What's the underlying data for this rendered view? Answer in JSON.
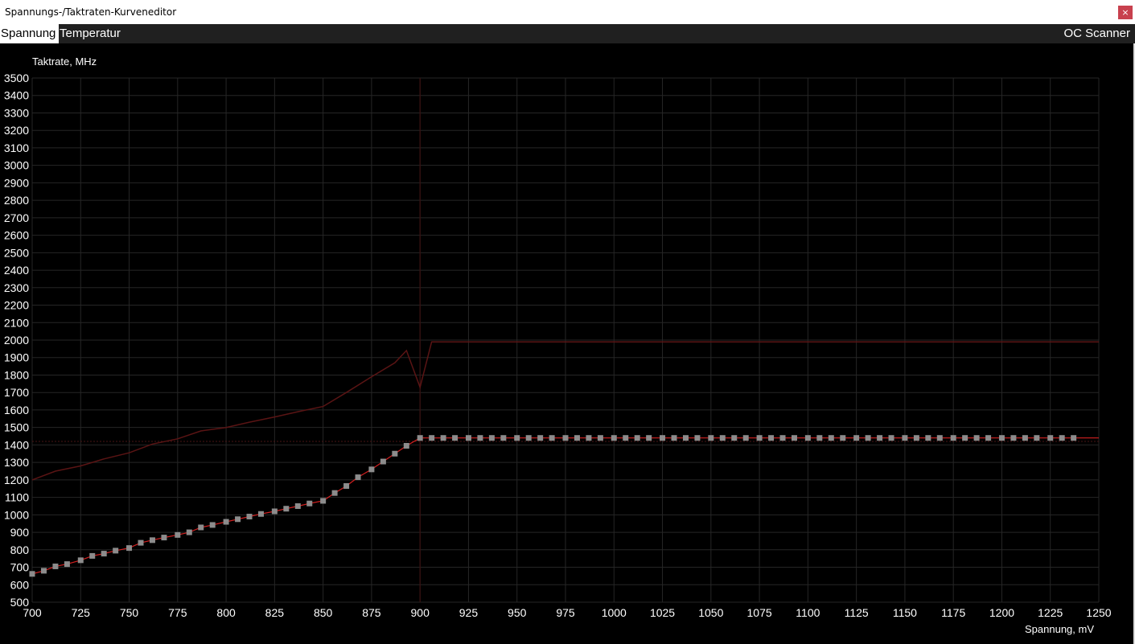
{
  "window": {
    "title": "Spannungs-/Taktraten-Kurveneditor",
    "close_label": "×"
  },
  "tabs": [
    {
      "label": "Spannung",
      "active": true
    },
    {
      "label": "Temperatur",
      "active": false
    }
  ],
  "oc_scanner_label": "OC Scanner",
  "colors": {
    "background": "#000000",
    "grid": "#262626",
    "curve": "#d42020",
    "max_curve": "#5a1414",
    "points": "#8c8c8c",
    "text": "#ffffff"
  },
  "chart_data": {
    "type": "line",
    "xlabel": "Spannung, mV",
    "ylabel": "Taktrate, MHz",
    "xlim": [
      700,
      1250
    ],
    "ylim": [
      500,
      3500
    ],
    "x_ticks": [
      700,
      725,
      750,
      775,
      800,
      825,
      850,
      875,
      900,
      925,
      950,
      975,
      1000,
      1025,
      1050,
      1075,
      1100,
      1125,
      1150,
      1175,
      1200,
      1225,
      1250
    ],
    "y_ticks": [
      500,
      600,
      700,
      800,
      900,
      1000,
      1100,
      1200,
      1300,
      1400,
      1500,
      1600,
      1700,
      1800,
      1900,
      2000,
      2100,
      2200,
      2300,
      2400,
      2500,
      2600,
      2700,
      2800,
      2900,
      3000,
      3100,
      3200,
      3300,
      3400,
      3500
    ],
    "grid": true,
    "current_voltage_marker": 900,
    "current_clock_marker": 1420,
    "series": [
      {
        "role": "max",
        "x": [
          700,
          712,
          725,
          737,
          750,
          762,
          775,
          787,
          800,
          812,
          825,
          837,
          850,
          862,
          875,
          887,
          893,
          900,
          906,
          1250
        ],
        "values": [
          1200,
          1250,
          1280,
          1320,
          1355,
          1405,
          1435,
          1480,
          1500,
          1530,
          1560,
          1590,
          1620,
          1700,
          1790,
          1870,
          1940,
          1730,
          1990,
          1990
        ]
      },
      {
        "role": "curve",
        "x": [
          700,
          706,
          712,
          718,
          725,
          731,
          737,
          743,
          750,
          756,
          762,
          768,
          775,
          781,
          787,
          793,
          800,
          806,
          812,
          818,
          825,
          831,
          837,
          843,
          850,
          856,
          862,
          868,
          875,
          881,
          887,
          893,
          900,
          906,
          912,
          918,
          925,
          931,
          937,
          943,
          950,
          956,
          962,
          968,
          975,
          981,
          987,
          993,
          1000,
          1006,
          1012,
          1018,
          1025,
          1031,
          1037,
          1043,
          1050,
          1056,
          1062,
          1068,
          1075,
          1081,
          1087,
          1093,
          1100,
          1106,
          1112,
          1118,
          1125,
          1131,
          1137,
          1143,
          1150,
          1156,
          1162,
          1168,
          1175,
          1181,
          1187,
          1193,
          1200,
          1206,
          1212,
          1218,
          1225,
          1231,
          1237
        ],
        "values": [
          662,
          680,
          705,
          718,
          740,
          765,
          778,
          795,
          810,
          840,
          855,
          870,
          885,
          900,
          928,
          942,
          960,
          975,
          990,
          1005,
          1020,
          1035,
          1050,
          1065,
          1080,
          1125,
          1165,
          1215,
          1260,
          1305,
          1350,
          1395,
          1440,
          1440,
          1440,
          1440,
          1440,
          1440,
          1440,
          1440,
          1440,
          1440,
          1440,
          1440,
          1440,
          1440,
          1440,
          1440,
          1440,
          1440,
          1440,
          1440,
          1440,
          1440,
          1440,
          1440,
          1440,
          1440,
          1440,
          1440,
          1440,
          1440,
          1440,
          1440,
          1440,
          1440,
          1440,
          1440,
          1440,
          1440,
          1440,
          1440,
          1440,
          1440,
          1440,
          1440,
          1440,
          1440,
          1440,
          1440,
          1440,
          1440,
          1440,
          1440,
          1440,
          1440,
          1440
        ]
      }
    ]
  }
}
